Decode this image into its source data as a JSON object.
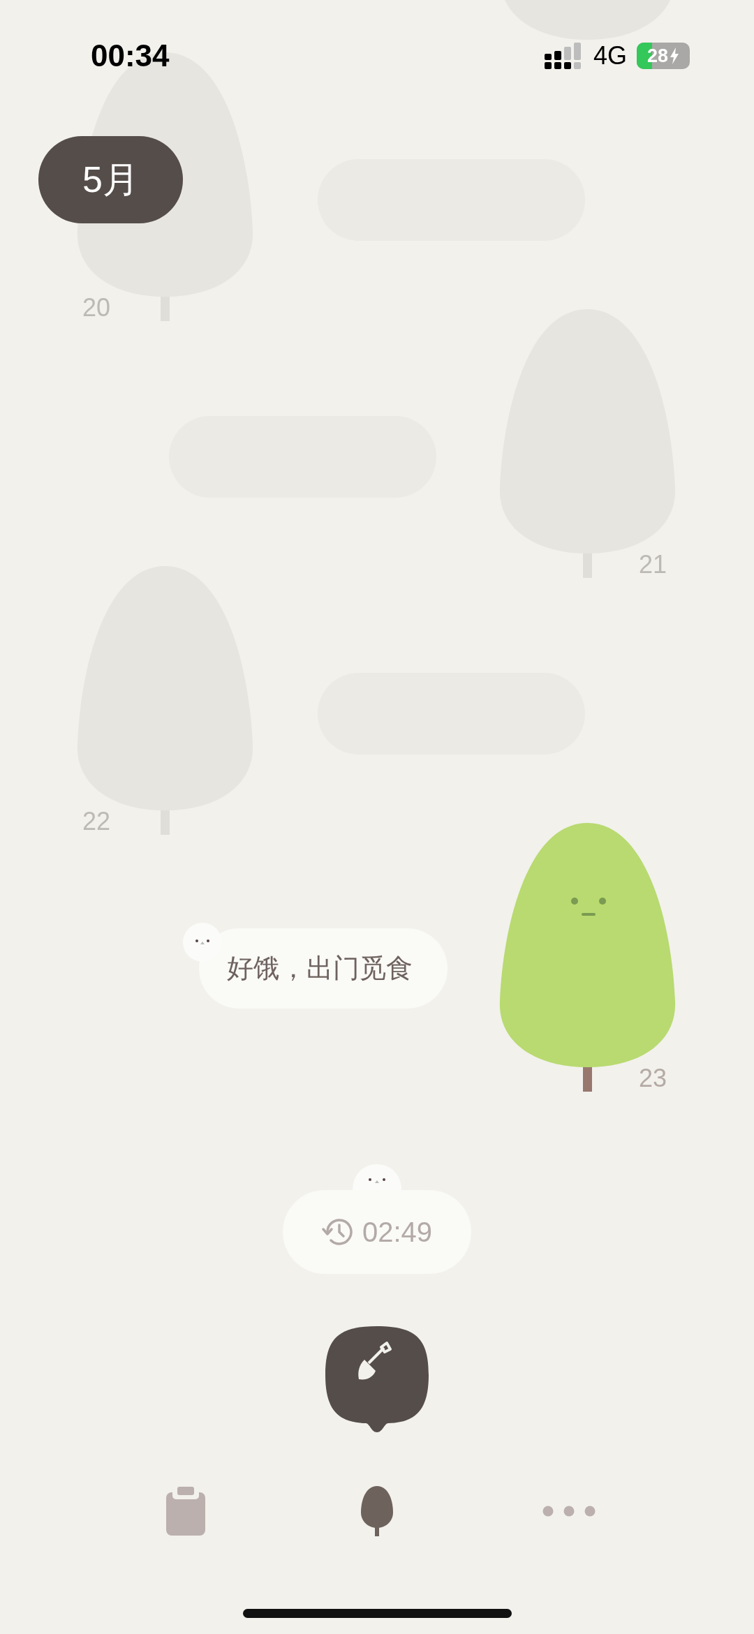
{
  "status_bar": {
    "time": "00:34",
    "network": "4G",
    "battery": "28",
    "charging": true
  },
  "month": "5月",
  "days": [
    {
      "grown": false
    },
    {
      "day": "20",
      "grown": false,
      "note": {
        "kind": "placeholder"
      }
    },
    {
      "day": "21",
      "grown": false,
      "note": {
        "kind": "placeholder"
      }
    },
    {
      "day": "22",
      "grown": false,
      "note": {
        "kind": "placeholder"
      }
    },
    {
      "day": "23",
      "grown": true,
      "note": {
        "kind": "message",
        "text": "好饿，出门觅食"
      }
    }
  ],
  "timer": "02:49",
  "nav": [
    {
      "kind": "records",
      "selected": false
    },
    {
      "kind": "forest",
      "selected": true
    },
    {
      "kind": "more",
      "selected": false
    }
  ]
}
